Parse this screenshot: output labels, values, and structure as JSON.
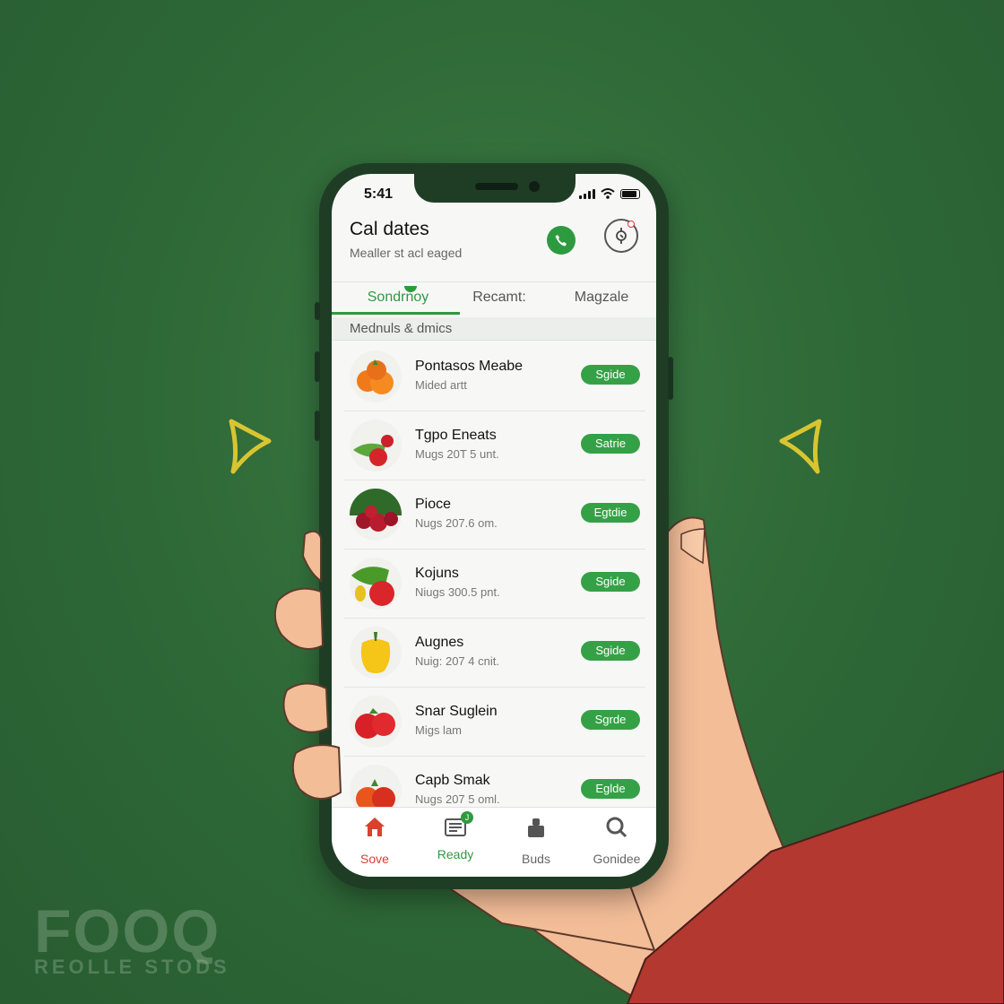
{
  "status_bar": {
    "time": "5:41"
  },
  "header": {
    "title": "Cal dates",
    "subtitle": "Mealler st acl eaged",
    "call_icon": "phone-icon",
    "settings_icon": "settings-icon"
  },
  "tabs": [
    {
      "label": "Sondrnoy",
      "active": true
    },
    {
      "label": "Recamt:",
      "active": false
    },
    {
      "label": "Magzale",
      "active": false
    }
  ],
  "section_header": "Mednuls & dmics",
  "items": [
    {
      "name": "Pontasos Meabe",
      "detail": "Mided artt",
      "button": "Sgide",
      "image": "oranges"
    },
    {
      "name": "Tgpo Eneats",
      "detail": "Mugs 20T 5 unt.",
      "button": "Satrie",
      "image": "tomato-greens"
    },
    {
      "name": "Pioce",
      "detail": "Nugs 207.6 om.",
      "button": "Egtdie",
      "image": "berries"
    },
    {
      "name": "Kojuns",
      "detail": "Niugs 300.5 pnt.",
      "button": "Sgide",
      "image": "vegetables"
    },
    {
      "name": "Augnes",
      "detail": "Nuig: 207 4 cnit.",
      "button": "Sgide",
      "image": "yellow-pepper"
    },
    {
      "name": "Snar Suglein",
      "detail": "Migs lam",
      "button": "Sgrde",
      "image": "red-tomatoes"
    },
    {
      "name": "Capb Smak",
      "detail": "Nugs 207 5 oml.",
      "button": "Eglde",
      "image": "orange-peppers"
    }
  ],
  "bottom_nav": [
    {
      "label": "Sove",
      "icon": "home-icon",
      "color": "#d9412e"
    },
    {
      "label": "Ready",
      "icon": "list-icon",
      "color": "#2e9a3f",
      "badge": "J"
    },
    {
      "label": "Buds",
      "icon": "bag-icon",
      "color": "#666666"
    },
    {
      "label": "Gonidee",
      "icon": "search-icon",
      "color": "#666666"
    }
  ],
  "watermark": {
    "big": "FOOQ",
    "small": "REOLLE STODS"
  },
  "colors": {
    "background": "#2f6a38",
    "accent": "#2e9a3f",
    "phone_frame": "#1f3d25",
    "sleeve": "#b3382f",
    "skin": "#f3bd98"
  }
}
